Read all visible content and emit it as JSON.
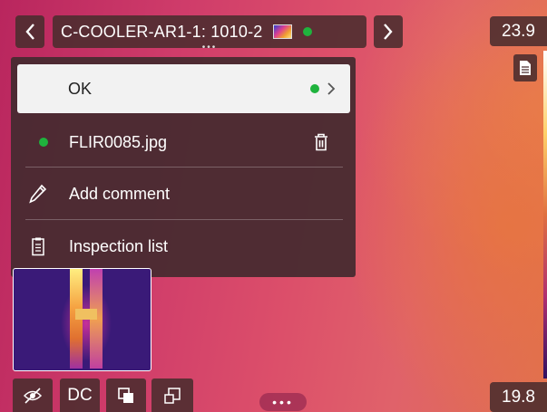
{
  "header": {
    "prev_icon": "chevron-left-icon",
    "next_icon": "chevron-right-icon",
    "title": "C-COOLER-AR1-1: 1010-2",
    "title_dots": "•••",
    "image_type_icon": "thermal-image-icon",
    "status_color": "#1fb33d"
  },
  "scale": {
    "max": "23.9",
    "min": "19.8"
  },
  "menu": {
    "ok_label": "OK",
    "file_name": "FLIR0085.jpg",
    "add_comment_label": "Add comment",
    "inspection_list_label": "Inspection list"
  },
  "toolbar": {
    "dc_label": "DC",
    "more_label": "•••"
  },
  "icons": {
    "doc": "document-icon",
    "hide": "eye-off-icon",
    "layers": "overlay-icon",
    "resize": "resize-icon",
    "pencil": "pencil-icon",
    "clipboard": "clipboard-icon",
    "trash": "trash-icon"
  }
}
